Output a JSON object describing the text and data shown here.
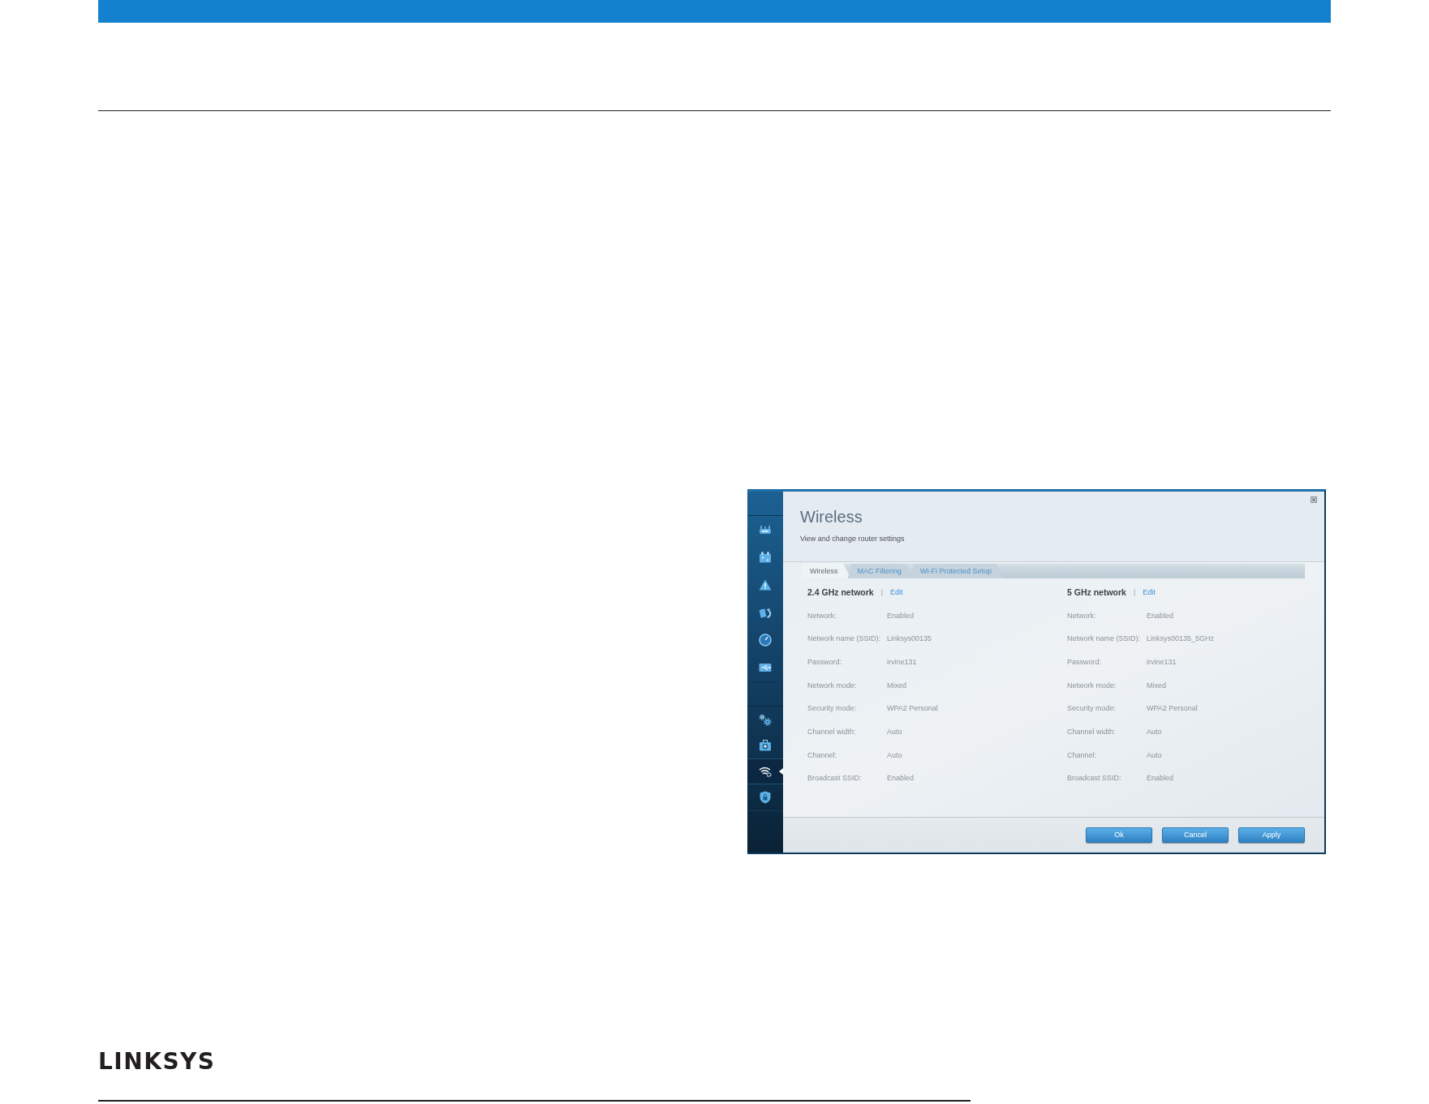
{
  "page": {
    "logo": "LINKSYS"
  },
  "screenshot": {
    "sidebar": {
      "top_items": [
        {
          "kind": "router",
          "selected": false
        },
        {
          "kind": "calendar",
          "selected": false
        },
        {
          "kind": "warning",
          "selected": false
        },
        {
          "kind": "refresh",
          "selected": false
        },
        {
          "kind": "gauge",
          "selected": false
        },
        {
          "kind": "usb",
          "selected": false
        }
      ],
      "bottom_items": [
        {
          "kind": "gears",
          "selected": false
        },
        {
          "kind": "medkit",
          "selected": false
        },
        {
          "kind": "wifi",
          "selected": true
        },
        {
          "kind": "shield",
          "selected": false
        }
      ]
    },
    "header": {
      "title": "Wireless",
      "subtitle": "View and change router settings"
    },
    "tabs": [
      {
        "label": "Wireless",
        "selected": true
      },
      {
        "label": "MAC Filtering",
        "selected": false
      },
      {
        "label": "Wi-Fi Protected Setup",
        "selected": false
      }
    ],
    "networks": [
      {
        "title": "2.4 GHz network",
        "separator": "|",
        "edit": "Edit",
        "fields": [
          {
            "label": "Network:",
            "value": "Enabled"
          },
          {
            "label": "Network name (SSID):",
            "value": "Linksys00135"
          },
          {
            "label": "Password:",
            "value": "irvine131"
          },
          {
            "label": "Network mode:",
            "value": "Mixed"
          },
          {
            "label": "Security mode:",
            "value": "WPA2 Personal"
          },
          {
            "label": "Channel width:",
            "value": "Auto"
          },
          {
            "label": "Channel:",
            "value": "Auto"
          },
          {
            "label": "Broadcast SSID:",
            "value": "Enabled"
          }
        ]
      },
      {
        "title": "5 GHz network",
        "separator": "|",
        "edit": "Edit",
        "fields": [
          {
            "label": "Network:",
            "value": "Enabled"
          },
          {
            "label": "Network name (SSID):",
            "value": "Linksys00135_5GHz"
          },
          {
            "label": "Password:",
            "value": "irvine131"
          },
          {
            "label": "Network mode:",
            "value": "Mixed"
          },
          {
            "label": "Security mode:",
            "value": "WPA2 Personal"
          },
          {
            "label": "Channel width:",
            "value": "Auto"
          },
          {
            "label": "Channel:",
            "value": "Auto"
          },
          {
            "label": "Broadcast SSID:",
            "value": "Enabled"
          }
        ]
      }
    ],
    "buttons": [
      "Ok",
      "Cancel",
      "Apply"
    ]
  }
}
